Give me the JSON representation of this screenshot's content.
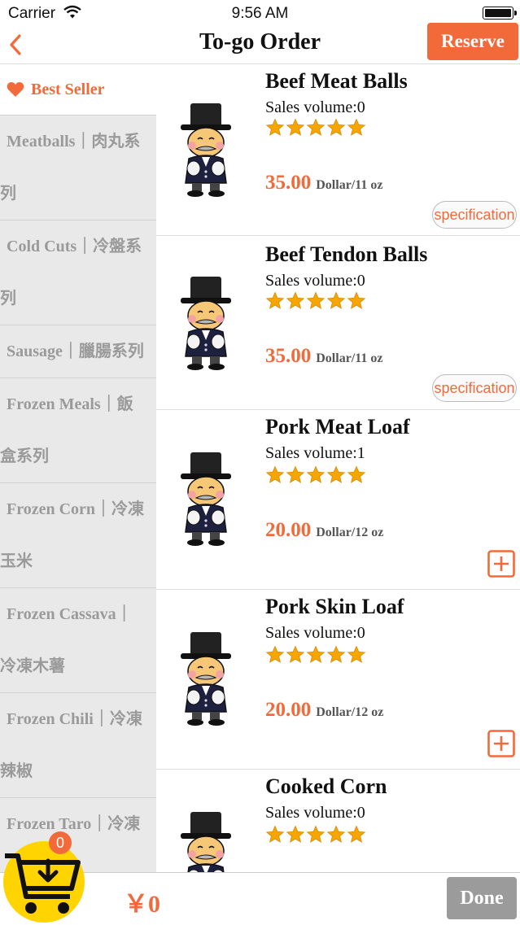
{
  "status_bar": {
    "carrier": "Carrier",
    "time": "9:56 AM"
  },
  "nav": {
    "title": "To-go Order",
    "reserve_label": "Reserve"
  },
  "sidebar": {
    "best_seller": "Best Seller",
    "categories": [
      {
        "line1": "Meatballs｜肉丸系",
        "line2": "列"
      },
      {
        "line1": "Cold Cuts｜冷盤系",
        "line2": "列"
      },
      {
        "line1": "Sausage｜臘腸系列",
        "line2": ""
      },
      {
        "line1": "Frozen Meals｜飯",
        "line2": "盒系列"
      },
      {
        "line1": "Frozen Corn｜冷凍",
        "line2": "玉米"
      },
      {
        "line1": "Frozen Cassava｜",
        "line2": "冷凍木薯"
      },
      {
        "line1": "Frozen Chili｜冷凍",
        "line2": "辣椒"
      },
      {
        "line1": "Frozen Taro｜冷凍",
        "line2": ""
      }
    ]
  },
  "products": [
    {
      "name": "Beef Meat Balls",
      "sales": "Sales volume:0",
      "rating": 5,
      "price": "35.00",
      "unit": "Dollar/11 oz",
      "action": "specification"
    },
    {
      "name": "Beef Tendon Balls",
      "sales": "Sales volume:0",
      "rating": 5,
      "price": "35.00",
      "unit": "Dollar/11 oz",
      "action": "specification"
    },
    {
      "name": "Pork Meat Loaf",
      "sales": "Sales volume:1",
      "rating": 5,
      "price": "20.00",
      "unit": "Dollar/12 oz",
      "action": "add"
    },
    {
      "name": "Pork Skin Loaf",
      "sales": "Sales volume:0",
      "rating": 5,
      "price": "20.00",
      "unit": "Dollar/12 oz",
      "action": "add"
    },
    {
      "name": "Cooked Corn",
      "sales": "Sales volume:0",
      "rating": 5,
      "price": "",
      "unit": "",
      "action": ""
    }
  ],
  "cart": {
    "count": "0",
    "total": "￥0",
    "done_label": "Done"
  },
  "colors": {
    "accent": "#f26a3a",
    "cart_yellow": "#ffd400",
    "sidebar_bg": "#e9e9e9",
    "done_bg": "#9b9b9b",
    "star": "#f7a500"
  }
}
